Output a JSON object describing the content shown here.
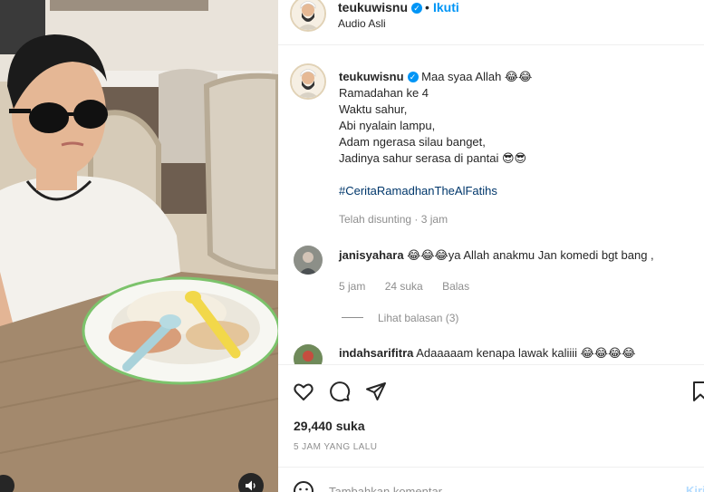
{
  "post": {
    "username": "teukuwisnu",
    "separator": "•",
    "follow_label": "Ikuti",
    "audio_label": "Audio Asli"
  },
  "caption": {
    "username": "teukuwisnu",
    "lines": [
      "Maa syaa Allah 😂😂",
      "Ramadahan ke 4",
      "Waktu sahur,",
      "Abi nyalain lampu,",
      "Adam ngerasa silau banget,",
      "Jadinya sahur serasa di pantai 😎😎"
    ],
    "hashtag": "#CeritaRamadhanTheAlFatihs",
    "edited": "Telah disunting",
    "dot": "·",
    "time": "3 jam"
  },
  "comments": [
    {
      "username": "janisyahara",
      "text": "😂😂😂ya Allah anakmu Jan komedi bgt bang ,",
      "time": "5 jam",
      "likes": "24 suka",
      "reply": "Balas",
      "view_replies": "Lihat balasan (3)"
    },
    {
      "username": "indahsarifitra",
      "text": "Adaaaaam kenapa lawak kaliiii 😂😂😂😂"
    }
  ],
  "actions": {
    "like_icon": "heart-icon",
    "comment_icon": "comment-icon",
    "share_icon": "paper-plane-icon",
    "save_icon": "bookmark-icon"
  },
  "likes_count": "29,440 suka",
  "time_ago": "5 JAM YANG LALU",
  "add_comment": {
    "placeholder": "Tambahkan komentar...",
    "post_label": "Kirim"
  },
  "colors": {
    "accent": "#0095f6",
    "hashtag": "#00376b",
    "muted": "#8e8e8e",
    "text": "#262626"
  }
}
